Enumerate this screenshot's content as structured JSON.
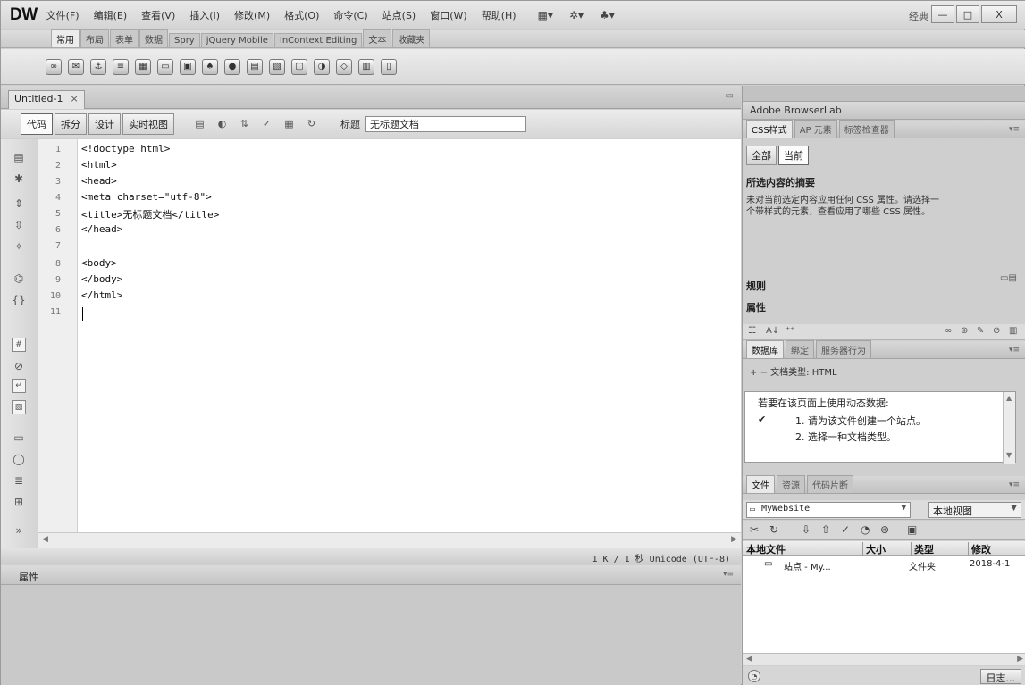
{
  "app": {
    "logo": "DW",
    "menus": [
      "文件(F)",
      "编辑(E)",
      "查看(V)",
      "插入(I)",
      "修改(M)",
      "格式(O)",
      "命令(C)",
      "站点(S)",
      "窗口(W)",
      "帮助(H)"
    ],
    "workspace": "经典 ▾",
    "tool_dropdowns": [
      "▦▾",
      "✲▾",
      "♣▾"
    ]
  },
  "insert_tabs": [
    "常用",
    "布局",
    "表单",
    "数据",
    "Spry",
    "jQuery Mobile",
    "InContext Editing",
    "文本",
    "收藏夹"
  ],
  "document": {
    "tab_label": "Untitled-1",
    "tab_close": "×",
    "view_buttons": [
      "代码",
      "拆分",
      "设计",
      "实时视图"
    ],
    "title_label": "标题",
    "title_value": "无标题文档"
  },
  "code": {
    "line_numbers": [
      "1",
      "2",
      "3",
      "4",
      "5",
      "6",
      "7",
      "8",
      "9",
      "10",
      "11"
    ],
    "lines": [
      "<!doctype html>",
      "<html>",
      "<head>",
      "<meta charset=\"utf-8\">",
      "<title>无标题文档</title>",
      "</head>",
      "",
      "<body>",
      "</body>",
      "</html>",
      ""
    ]
  },
  "status": {
    "text": "1 K / 1 秒 Unicode (UTF-8)"
  },
  "properties": {
    "title": "属性"
  },
  "right_panel": {
    "browserlab": "Adobe BrowserLab",
    "css_tabs": [
      "CSS样式",
      "AP 元素",
      "标签检查器"
    ],
    "mode_buttons": [
      "全部",
      "当前"
    ],
    "summary_title": "所选内容的摘要",
    "summary_text_1": "未对当前选定内容应用任何 CSS 属性。请选择一",
    "summary_text_2": "个带样式的元素，查看应用了哪些 CSS 属性。",
    "rules_title": "规则",
    "props_title": "属性",
    "db_tabs": [
      "数据库",
      "绑定",
      "服务器行为"
    ],
    "doctype_label": "文档类型: HTML",
    "dynamic_intro": "若要在该页面上使用动态数据:",
    "dynamic_step1": "1. 请为该文件创建一个站点。",
    "dynamic_step2": "2. 选择一种文档类型。",
    "files_tabs": [
      "文件",
      "资源",
      "代码片断"
    ],
    "site_name": "MyWebsite",
    "view_mode": "本地视图",
    "file_headers": [
      "本地文件",
      "大小",
      "类型",
      "修改"
    ],
    "file_row": {
      "name": "站点 - My...",
      "type": "文件夹",
      "modified": "2018-4-1"
    },
    "log_button": "日志..."
  }
}
